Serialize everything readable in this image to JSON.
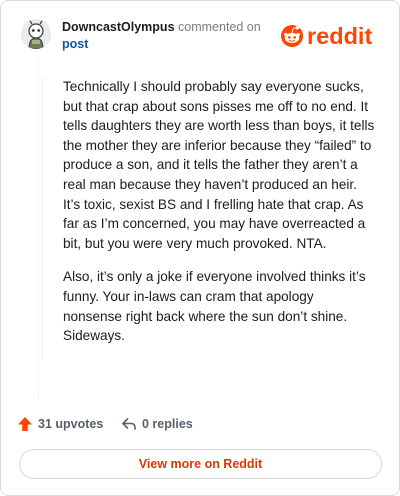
{
  "header": {
    "username": "DowncastOlympus",
    "action": "commented on",
    "target": "post",
    "logo_text": "reddit"
  },
  "comment": {
    "paragraphs": [
      "Technically I should probably say everyone sucks, but that crap about sons pisses me off to no end. It tells daughters they are worth less than boys, it tells the mother they are inferior because they “failed” to produce a son, and it tells the father they aren’t a real man because they haven’t produced an heir. It’s toxic, sexist BS and I frelling hate that crap. As far as I’m concerned, you may have overreacted a bit, but you were very much provoked. NTA.",
      "Also, it’s only a joke if everyone involved thinks it’s funny. Your in-laws can cram that apology nonsense right back where the sun don’t shine. Sideways."
    ]
  },
  "actions": {
    "upvotes": "31 upvotes",
    "replies": "0 replies"
  },
  "footer": {
    "view_more": "View more on Reddit"
  },
  "colors": {
    "brand": "#ff4500",
    "link": "#0e56a8",
    "view_more_text": "#d93a00"
  },
  "icons": {
    "avatar": "snoo-avatar",
    "upvote": "upvote-arrow-icon",
    "reply": "reply-arrow-icon"
  }
}
